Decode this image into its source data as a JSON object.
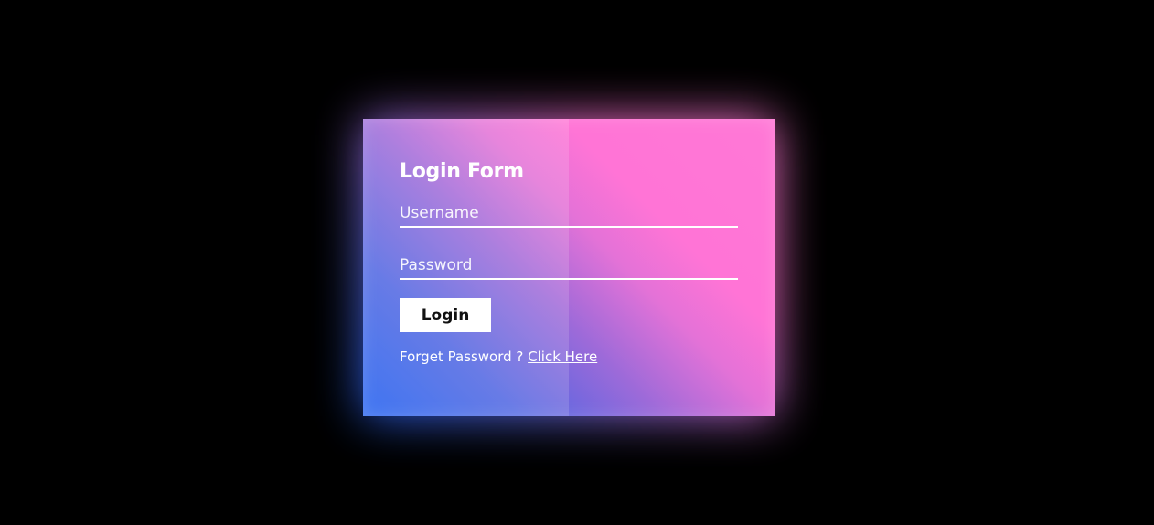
{
  "login_form": {
    "title": "Login Form",
    "username_placeholder": "Username",
    "password_placeholder": "Password",
    "login_button_label": "Login",
    "forgot_text": "Forget Password ? ",
    "forgot_link_label": "Click Here"
  },
  "colors": {
    "background": "#000000",
    "gradient_blue": "#1e5ef0",
    "gradient_pink": "#ff74d6",
    "text": "#ffffff",
    "button_bg": "#ffffff",
    "button_text": "#111111"
  }
}
